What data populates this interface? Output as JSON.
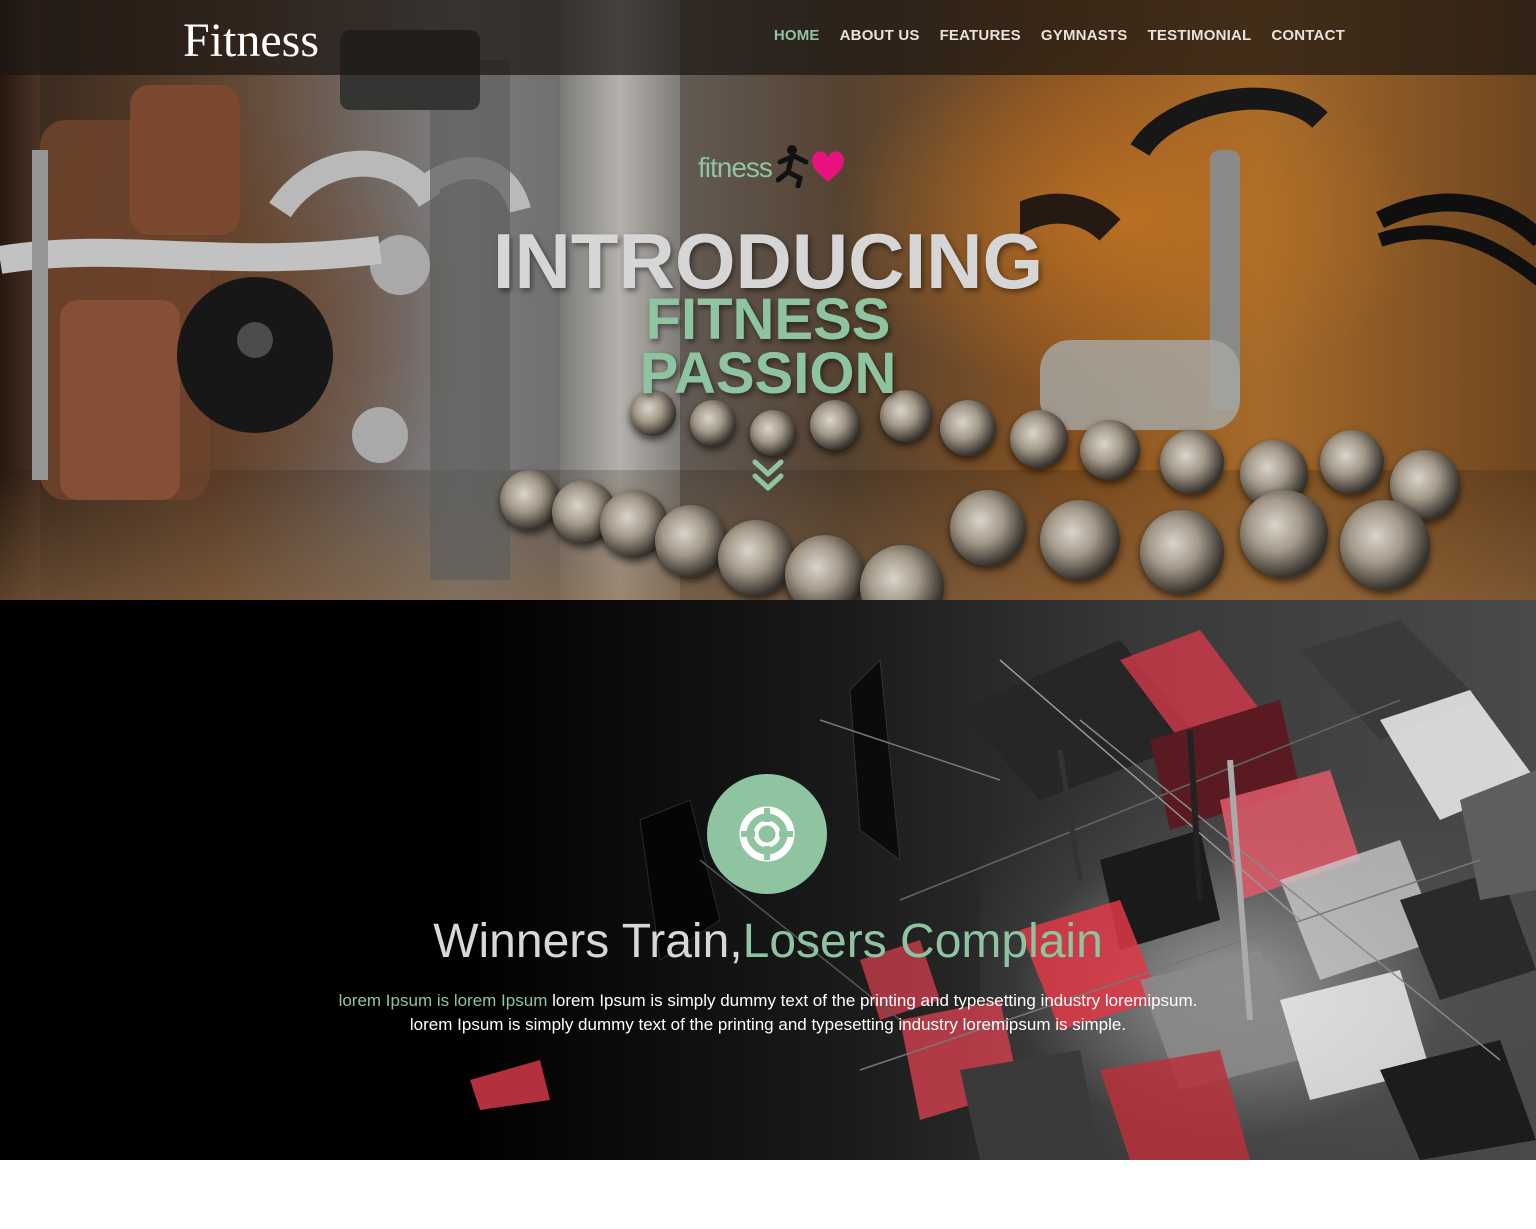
{
  "brand": "Fitness",
  "nav": {
    "items": [
      "HOME",
      "ABOUT US",
      "FEATURES",
      "GYMNASTS",
      "TESTIMONIAL",
      "CONTACT"
    ],
    "active": "HOME"
  },
  "hero": {
    "logo_text": "fitness",
    "heading_1": "INTRODUCING",
    "heading_2": "FITNESS",
    "heading_3": "PASSION",
    "scroll_icon": "double-chevron-down-icon"
  },
  "feature": {
    "icon": "life-ring-icon",
    "tagline_part1": "Winners Train,",
    "tagline_part2": "Losers Complain",
    "desc_highlight": "lorem Ipsum is lorem Ipsum",
    "desc_text": " lorem Ipsum is simply dummy text of the printing and typesetting industry loremipsum. lorem Ipsum is simply dummy text of the printing and typesetting industry loremipsum is simple."
  },
  "colors": {
    "accent": "#8ec4a0",
    "heart": "#e8137e",
    "nav_bg": "#1c1612"
  }
}
